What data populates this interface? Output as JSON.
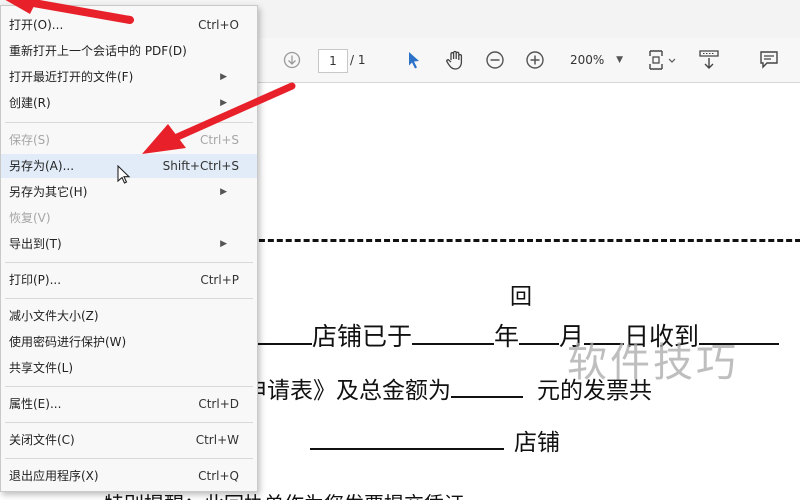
{
  "toolbar": {
    "page_current": "1",
    "page_total": "/ 1",
    "zoom": "200%",
    "icons": [
      "down-circle-icon",
      "select-arrow-icon",
      "hand-icon",
      "zoom-out-icon",
      "zoom-in-icon",
      "fit-page-icon",
      "scroll-icon",
      "comment-icon"
    ]
  },
  "menu": {
    "items": [
      {
        "label": "打开(O)...",
        "shortcut": "Ctrl+O"
      },
      {
        "label": "重新打开上一个会话中的 PDF(D)",
        "shortcut": ""
      },
      {
        "label": "打开最近打开的文件(F)",
        "shortcut": ""
      },
      {
        "label": "创建(R)",
        "shortcut": ""
      },
      {
        "label": "保存(S)",
        "shortcut": "Ctrl+S"
      },
      {
        "label": "另存为(A)...",
        "shortcut": "Shift+Ctrl+S"
      },
      {
        "label": "另存为其它(H)",
        "shortcut": ""
      },
      {
        "label": "恢复(V)",
        "shortcut": ""
      },
      {
        "label": "导出到(T)",
        "shortcut": ""
      },
      {
        "label": "打印(P)...",
        "shortcut": "Ctrl+P"
      },
      {
        "label": "减小文件大小(Z)",
        "shortcut": ""
      },
      {
        "label": "使用密码进行保护(W)",
        "shortcut": ""
      },
      {
        "label": "共享文件(L)",
        "shortcut": ""
      },
      {
        "label": "属性(E)...",
        "shortcut": "Ctrl+D"
      },
      {
        "label": "关闭文件(C)",
        "shortcut": "Ctrl+W"
      },
      {
        "label": "退出应用程序(X)",
        "shortcut": "Ctrl+Q"
      }
    ]
  },
  "document": {
    "line1": "回",
    "line2_a": "店铺已于",
    "line2_b": "年",
    "line2_c": "月",
    "line2_d": "日收到",
    "line3_a": "申请表》及总金额为",
    "line3_b": "元的发票共",
    "line4": "店铺",
    "line5": "特别提醒：此回执单作为您发票提交凭证"
  },
  "watermark": "软件技巧",
  "colors": {
    "arrow": "#e8202a",
    "menu_hover": "#e2ecf8",
    "select_icon": "#2c72c7"
  }
}
